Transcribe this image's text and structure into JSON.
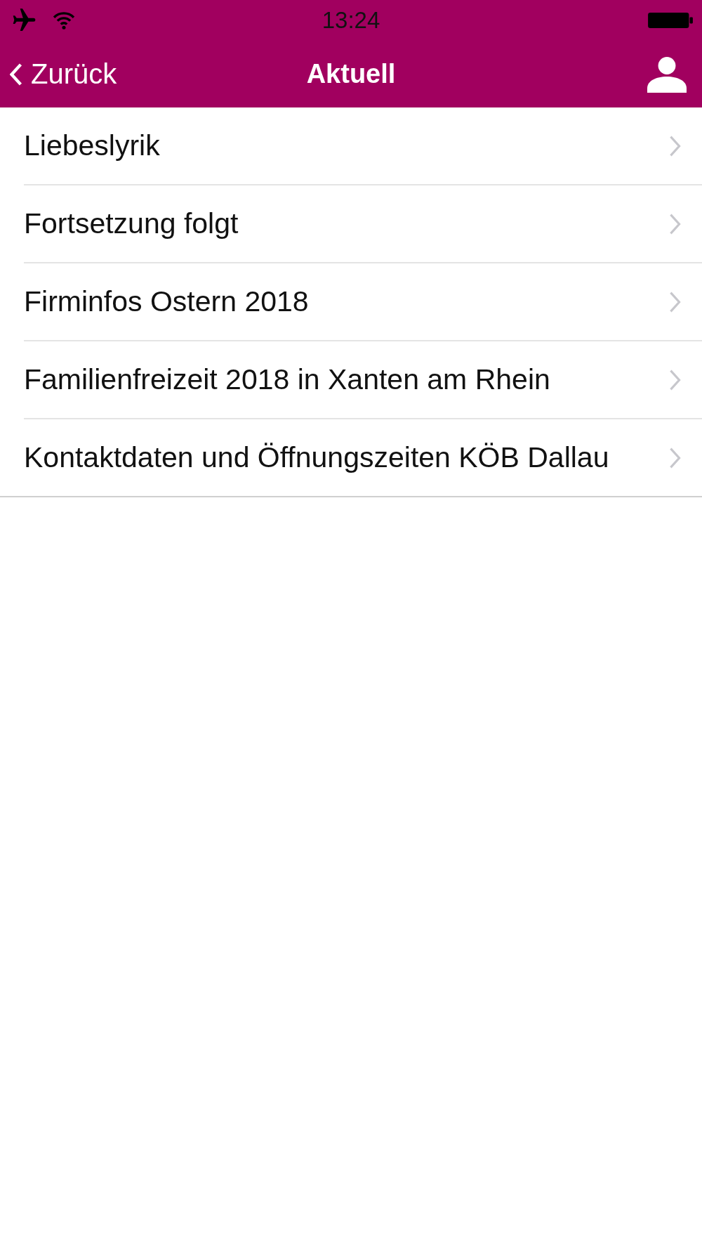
{
  "status_bar": {
    "time": "13:24"
  },
  "nav_bar": {
    "back": "Zurück",
    "title": "Aktuell"
  },
  "items": [
    {
      "label": "Liebeslyrik"
    },
    {
      "label": "Fortsetzung folgt"
    },
    {
      "label": "Firminfos Ostern 2018"
    },
    {
      "label": "Familienfreizeit 2018 in Xanten am Rhein"
    },
    {
      "label": "Kontaktdaten und Öffnungszeiten KÖB Dallau"
    }
  ]
}
